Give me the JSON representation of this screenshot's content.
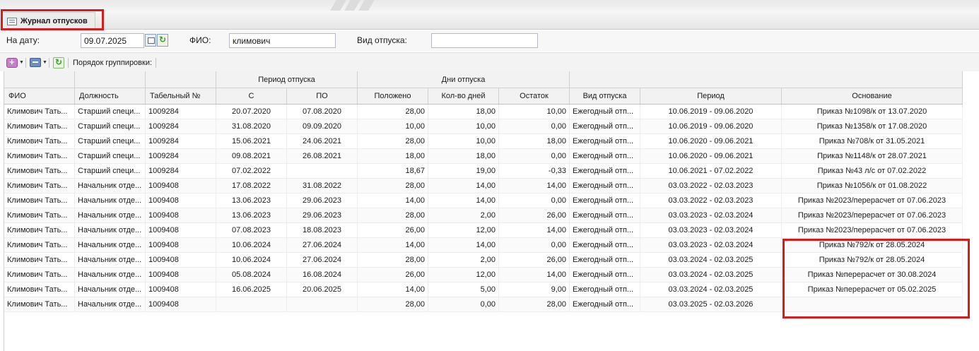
{
  "tab": {
    "title": "Журнал отпусков"
  },
  "filters": {
    "date_label": "На дату:",
    "date_value": "09.07.2025",
    "fio_label": "ФИО:",
    "fio_value": "климович",
    "type_label": "Вид отпуска:",
    "type_value": ""
  },
  "toolbar": {
    "grouping_label": "Порядок группировки:"
  },
  "grid": {
    "group_headers": {
      "period": "Период отпуска",
      "days": "Дни отпуска"
    },
    "columns": [
      "ФИО",
      "Должность",
      "Табельный №",
      "С",
      "ПО",
      "Положено",
      "Кол-во дней",
      "Остаток",
      "Вид отпуска",
      "Период",
      "Основание"
    ],
    "rows": [
      [
        "Климович Тать...",
        "Старший специ...",
        "1009284",
        "20.07.2020",
        "07.08.2020",
        "28,00",
        "18,00",
        "10,00",
        "Ежегодный отп...",
        "10.06.2019 - 09.06.2020",
        "Приказ №1098/к от 13.07.2020"
      ],
      [
        "Климович Тать...",
        "Старший специ...",
        "1009284",
        "31.08.2020",
        "09.09.2020",
        "10,00",
        "10,00",
        "0,00",
        "Ежегодный отп...",
        "10.06.2019 - 09.06.2020",
        "Приказ №1358/к от 17.08.2020"
      ],
      [
        "Климович Тать...",
        "Старший специ...",
        "1009284",
        "15.06.2021",
        "24.06.2021",
        "28,00",
        "10,00",
        "18,00",
        "Ежегодный отп...",
        "10.06.2020 - 09.06.2021",
        "Приказ №708/к от 31.05.2021"
      ],
      [
        "Климович Тать...",
        "Старший специ...",
        "1009284",
        "09.08.2021",
        "26.08.2021",
        "18,00",
        "18,00",
        "0,00",
        "Ежегодный отп...",
        "10.06.2020 - 09.06.2021",
        "Приказ №1148/к от 28.07.2021"
      ],
      [
        "Климович Тать...",
        "Старший специ...",
        "1009284",
        "07.02.2022",
        "",
        "18,67",
        "19,00",
        "-0,33",
        "Ежегодный отп...",
        "10.06.2021 - 07.02.2022",
        "Приказ №43 л/с от 07.02.2022"
      ],
      [
        "Климович Тать...",
        "Начальник отде...",
        "1009408",
        "17.08.2022",
        "31.08.2022",
        "28,00",
        "14,00",
        "14,00",
        "Ежегодный отп...",
        "03.03.2022 - 02.03.2023",
        "Приказ №1056/к от 01.08.2022"
      ],
      [
        "Климович Тать...",
        "Начальник отде...",
        "1009408",
        "13.06.2023",
        "29.06.2023",
        "14,00",
        "14,00",
        "0,00",
        "Ежегодный отп...",
        "03.03.2022 - 02.03.2023",
        "Приказ №2023/перерасчет от 07.06.2023"
      ],
      [
        "Климович Тать...",
        "Начальник отде...",
        "1009408",
        "13.06.2023",
        "29.06.2023",
        "28,00",
        "2,00",
        "26,00",
        "Ежегодный отп...",
        "03.03.2023 - 02.03.2024",
        "Приказ №2023/перерасчет от 07.06.2023"
      ],
      [
        "Климович Тать...",
        "Начальник отде...",
        "1009408",
        "07.08.2023",
        "18.08.2023",
        "26,00",
        "12,00",
        "14,00",
        "Ежегодный отп...",
        "03.03.2023 - 02.03.2024",
        "Приказ №2023/перерасчет от 07.06.2023"
      ],
      [
        "Климович Тать...",
        "Начальник отде...",
        "1009408",
        "10.06.2024",
        "27.06.2024",
        "14,00",
        "14,00",
        "0,00",
        "Ежегодный отп...",
        "03.03.2023 - 02.03.2024",
        "Приказ №792/к от 28.05.2024"
      ],
      [
        "Климович Тать...",
        "Начальник отде...",
        "1009408",
        "10.06.2024",
        "27.06.2024",
        "28,00",
        "2,00",
        "26,00",
        "Ежегодный отп...",
        "03.03.2024 - 02.03.2025",
        "Приказ №792/к от 28.05.2024"
      ],
      [
        "Климович Тать...",
        "Начальник отде...",
        "1009408",
        "05.08.2024",
        "16.08.2024",
        "26,00",
        "12,00",
        "14,00",
        "Ежегодный отп...",
        "03.03.2024 - 02.03.2025",
        "Приказ №перерасчет от 30.08.2024"
      ],
      [
        "Климович Тать...",
        "Начальник отде...",
        "1009408",
        "16.06.2025",
        "20.06.2025",
        "14,00",
        "5,00",
        "9,00",
        "Ежегодный отп...",
        "03.03.2024 - 02.03.2025",
        "Приказ №перерасчет от 05.02.2025"
      ],
      [
        "Климович Тать...",
        "Начальник отде...",
        "1009408",
        "",
        "",
        "28,00",
        "0,00",
        "28,00",
        "Ежегодный отп...",
        "03.03.2025 - 02.03.2026",
        ""
      ]
    ]
  },
  "colors": {
    "highlight": "#d61c1c",
    "header_bg": "#f2f2f2"
  }
}
